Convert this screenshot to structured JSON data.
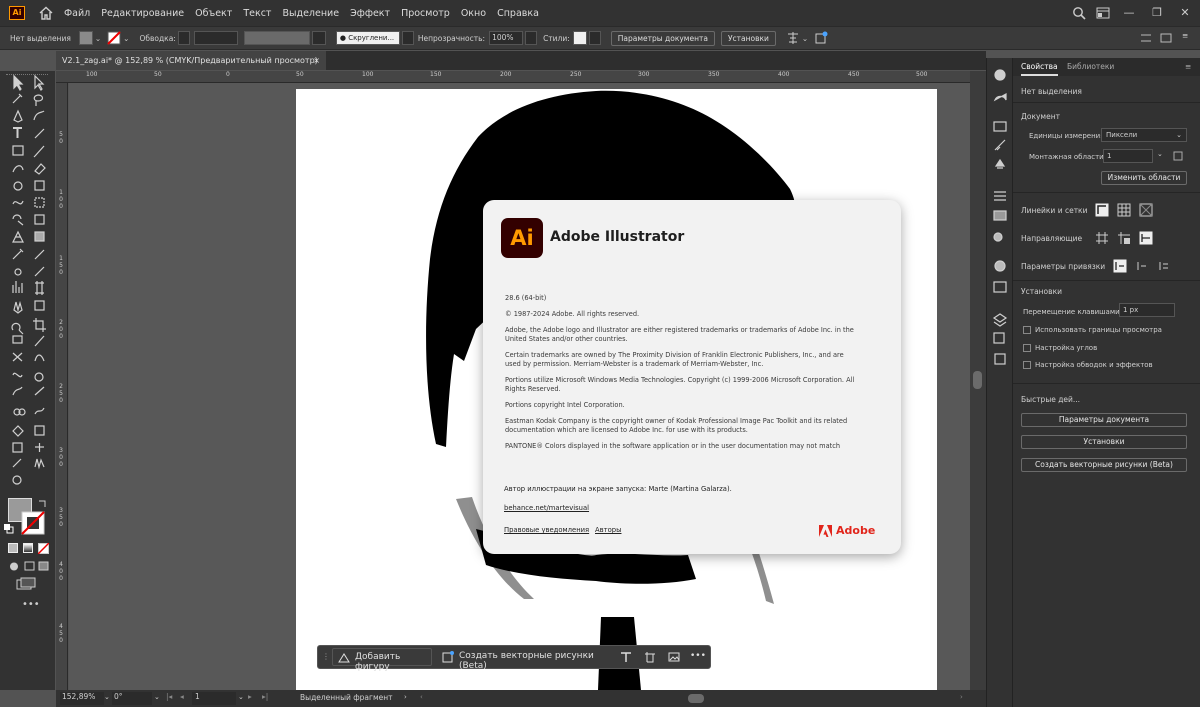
{
  "menubar": {
    "app_logo": "Ai",
    "items": [
      "Файл",
      "Редактирование",
      "Объект",
      "Текст",
      "Выделение",
      "Эффект",
      "Просмотр",
      "Окно",
      "Справка"
    ]
  },
  "control_bar": {
    "selection": "Нет выделения",
    "stroke_label": "Обводка:",
    "brush_label": "Скруглени...",
    "opacity_label": "Непрозрачность:",
    "opacity_value": "100%",
    "styles_label": "Стили:",
    "doc_settings": "Параметры документа",
    "preferences": "Установки"
  },
  "document_tab": {
    "title": "V2.1_zag.ai* @ 152,89 % (CMYK/Предварительный просмотр)",
    "close": "×"
  },
  "ruler": {
    "h_ticks": [
      "100",
      "50",
      "0",
      "50",
      "100",
      "150",
      "200",
      "250",
      "300",
      "350",
      "400",
      "450",
      "500"
    ],
    "v_ticks": [
      "5\n0",
      "1\n0\n0",
      "1\n5\n0",
      "2\n0\n0",
      "2\n5\n0",
      "3\n0\n0",
      "3\n5\n0",
      "4\n0\n0",
      "4\n5\n0"
    ]
  },
  "statusbar": {
    "zoom": "152,89%",
    "rotation": "0°",
    "artboard_nav": "1",
    "status": "Выделенный фрагмент"
  },
  "contextual_bar": {
    "add_shape": "Добавить фигуру",
    "create_vector": "Создать векторные рисунки (Beta)",
    "more": "•••"
  },
  "about": {
    "logo": "Ai",
    "title": "Adobe Illustrator",
    "paragraphs": [
      "28.6 (64-bit)",
      "© 1987-2024 Adobe. All rights reserved.",
      "Adobe, the Adobe logo and Illustrator are either registered trademarks or trademarks of Adobe Inc. in the United States and/or other countries.",
      "Certain trademarks are owned by The Proximity Division of Franklin Electronic Publishers, Inc., and are used by permission. Merriam-Webster is a trademark of Merriam-Webster, Inc.",
      "Portions utilize Microsoft Windows Media Technologies. Copyright (c) 1999-2006 Microsoft Corporation. All Rights Reserved.",
      "Portions copyright Intel Corporation.",
      "Eastman Kodak Company is the copyright owner of Kodak Professional Image Pac Toolkit and its related documentation which are licensed to Adobe Inc. for use with its products.",
      "PANTONE® Colors displayed in the software application or in the user documentation may not match"
    ],
    "credit": "Автор иллюстрации на экране запуска: Marte (Martina Galarza).",
    "behance": "behance.net/martevisual",
    "legal": "Правовые уведомления",
    "authors": "Авторы",
    "brand": "Adobe"
  },
  "panel": {
    "tabs": [
      "Свойства",
      "Библиотеки"
    ],
    "no_selection": "Нет выделения",
    "document_heading": "Документ",
    "units_label": "Единицы измерения:",
    "units_value": "Пиксели",
    "artboards_label": "Монтажная области:",
    "artboards_value": "1",
    "edit_artboards": "Изменить области",
    "rulers_grids": "Линейки и сетки",
    "guides": "Направляющие",
    "snap_options": "Параметры привязки",
    "prefs_heading": "Установки",
    "keyboard_increment_label": "Перемещение клавишами:",
    "keyboard_increment_value": "1 px",
    "use_preview_bounds": "Использовать границы просмотра",
    "scale_corners": "Настройка углов",
    "scale_strokes": "Настройка обводок и эффектов",
    "quick_actions": "Быстрые дей...",
    "qa_doc_settings": "Параметры документа",
    "qa_preferences": "Установки",
    "qa_create_vector": "Создать векторные рисунки (Beta)"
  },
  "colors": {
    "ui_dark": "#323232",
    "canvas": "#585858",
    "ai_orange": "#ff9a00",
    "ai_dark": "#330000",
    "adobe_red": "#e1251b"
  }
}
